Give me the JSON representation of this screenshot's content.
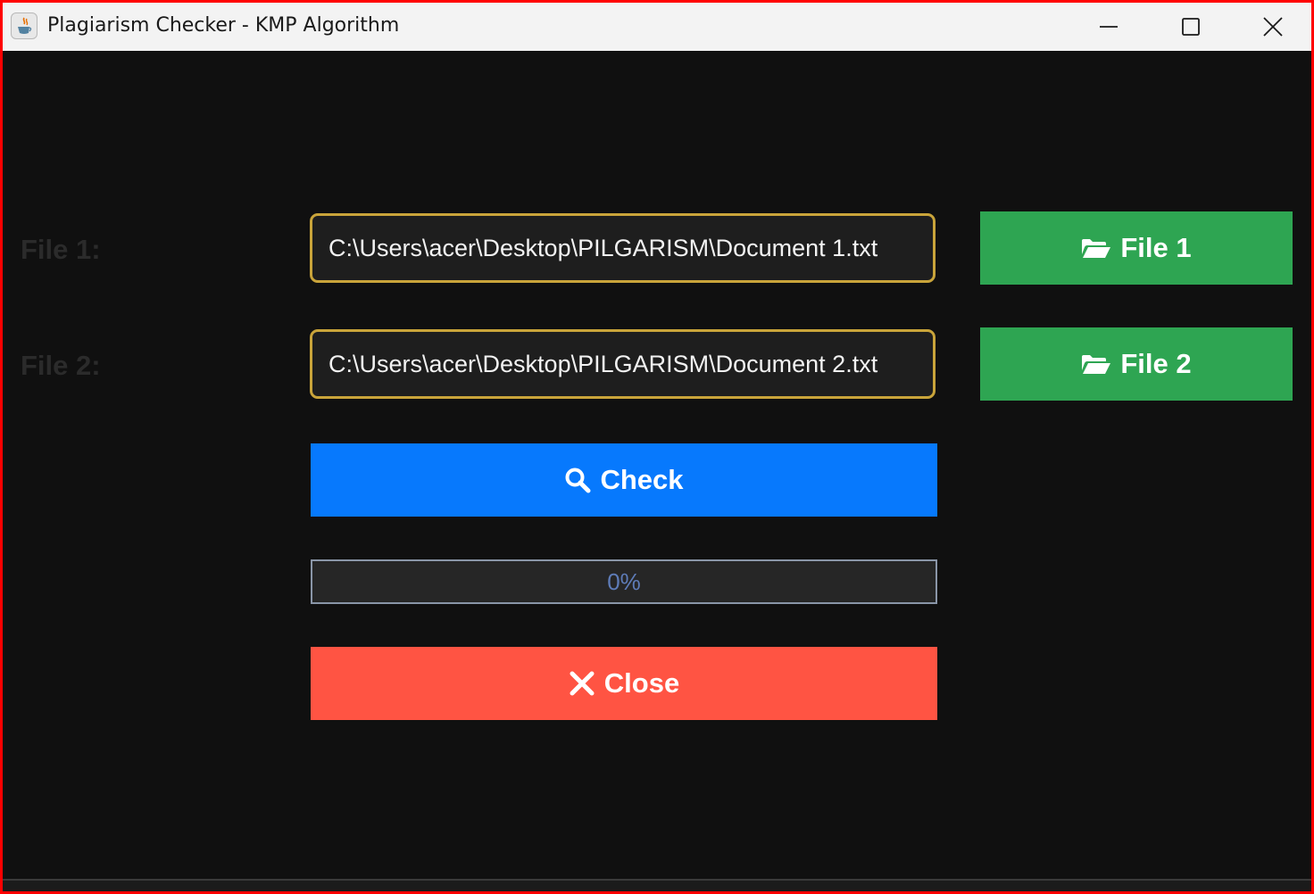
{
  "window": {
    "title": "Plagiarism Checker - KMP Algorithm",
    "app_icon": "java-icon",
    "controls": [
      "minimize-icon",
      "maximize-icon",
      "close-icon"
    ]
  },
  "form": {
    "file1": {
      "label": "File 1:",
      "path": "C:\\Users\\acer\\Desktop\\PILGARISM\\Document 1.txt",
      "button_label": "File 1",
      "button_icon": "folder-open-icon"
    },
    "file2": {
      "label": "File 2:",
      "path": "C:\\Users\\acer\\Desktop\\PILGARISM\\Document 2.txt",
      "button_label": "File 2",
      "button_icon": "folder-open-icon"
    },
    "check": {
      "label": "Check",
      "icon": "search-icon"
    },
    "progress": {
      "value": 0,
      "text": "0%"
    },
    "close": {
      "label": "Close",
      "icon": "x-icon"
    }
  },
  "colors": {
    "background": "#101010",
    "field_border": "#c9a43a",
    "file_button": "#2ea552",
    "check_button": "#0779fd",
    "close_button": "#ff5443",
    "window_frame": "#ff0000"
  }
}
